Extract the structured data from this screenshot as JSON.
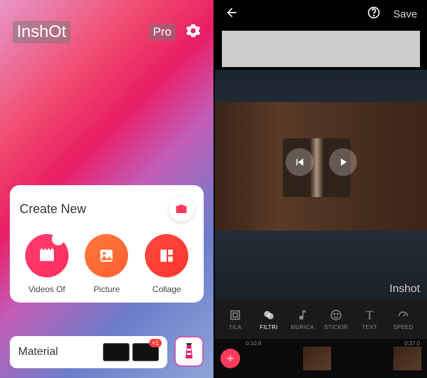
{
  "left": {
    "app_name": "InshOt",
    "pro": "Pro",
    "create_title": "Create New",
    "options": {
      "video": "Videos Of",
      "picture": "Picture",
      "collage": "Collage"
    },
    "material": "Material",
    "badge": "+1"
  },
  "right": {
    "save": "Save",
    "watermark": "Inshot",
    "tools": {
      "tile": "TILA",
      "filter": "FILTRI",
      "music": "MURICA",
      "sticker": "STICKIR",
      "text": "TEXT",
      "speed": "SPEED"
    },
    "timeline": {
      "t1": "0:10.9",
      "t2": "0:37.0"
    }
  }
}
